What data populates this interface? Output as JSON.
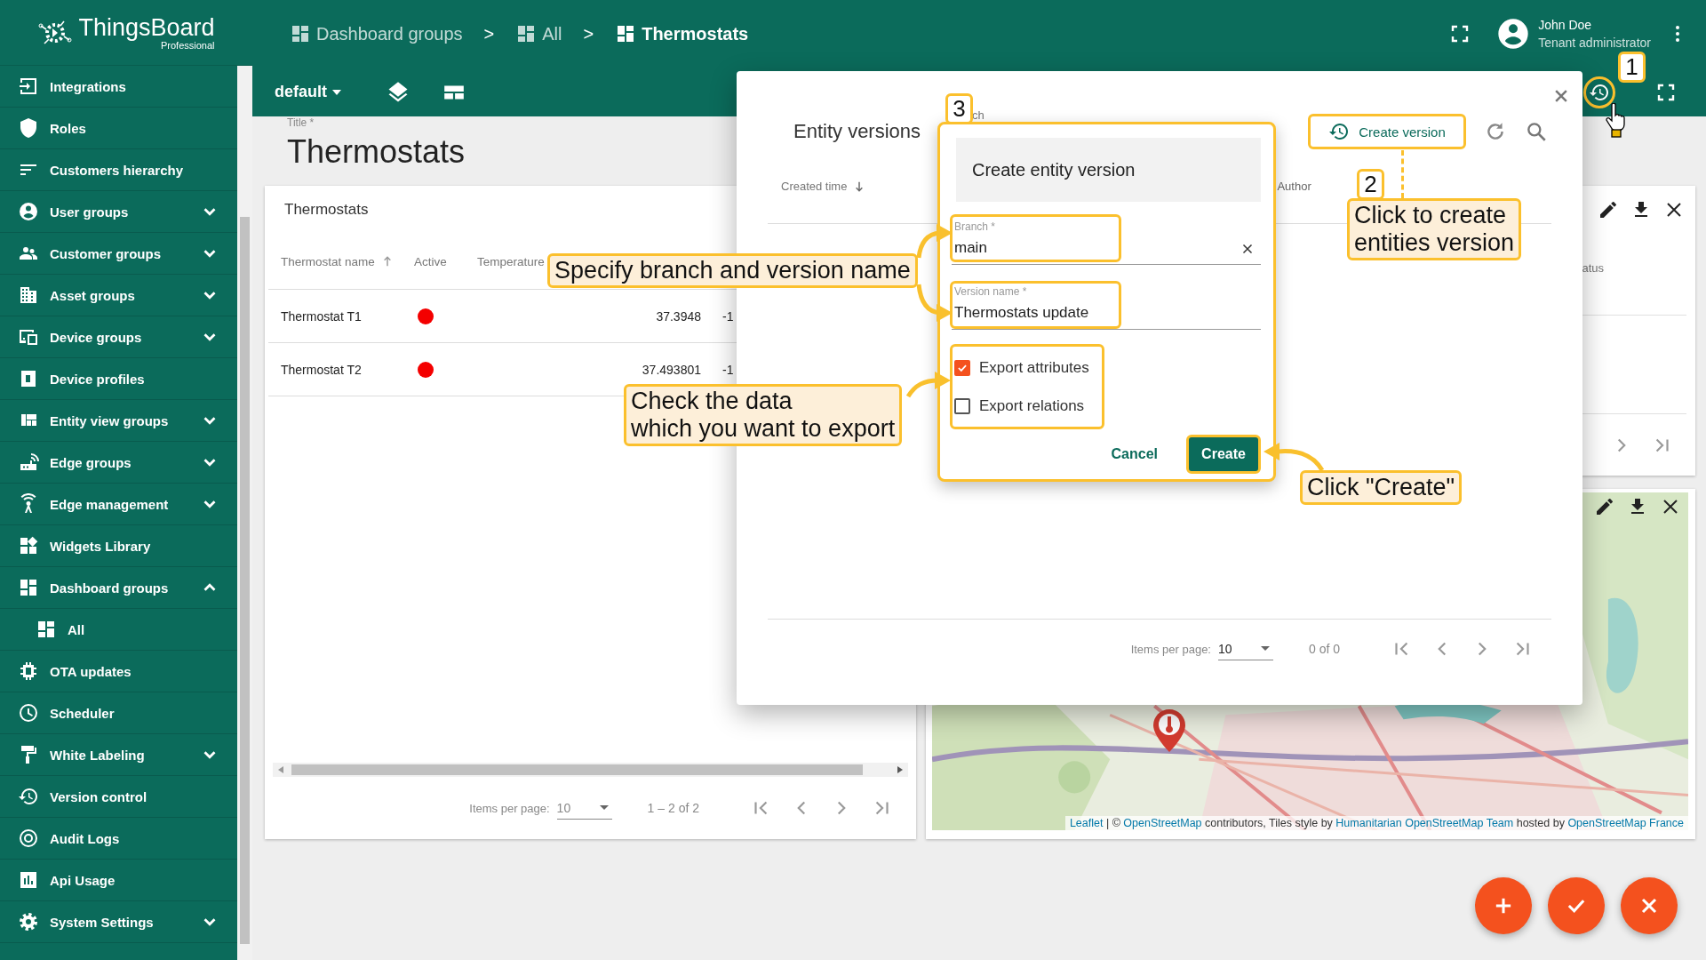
{
  "sidebar": {
    "logo": {
      "name": "ThingsBoard",
      "edition": "Professional"
    },
    "items": [
      {
        "label": "Integrations",
        "kind": "link"
      },
      {
        "label": "Roles",
        "kind": "link"
      },
      {
        "label": "Customers hierarchy",
        "kind": "link"
      },
      {
        "label": "User groups",
        "kind": "group",
        "expanded": false
      },
      {
        "label": "Customer groups",
        "kind": "group",
        "expanded": false
      },
      {
        "label": "Asset groups",
        "kind": "group",
        "expanded": false
      },
      {
        "label": "Device groups",
        "kind": "group",
        "expanded": false
      },
      {
        "label": "Device profiles",
        "kind": "link"
      },
      {
        "label": "Entity view groups",
        "kind": "group",
        "expanded": false
      },
      {
        "label": "Edge groups",
        "kind": "group",
        "expanded": false
      },
      {
        "label": "Edge management",
        "kind": "group",
        "expanded": false
      },
      {
        "label": "Widgets Library",
        "kind": "link"
      },
      {
        "label": "Dashboard groups",
        "kind": "group",
        "expanded": true,
        "children": [
          {
            "label": "All"
          }
        ]
      },
      {
        "label": "OTA updates",
        "kind": "link"
      },
      {
        "label": "Scheduler",
        "kind": "link"
      },
      {
        "label": "White Labeling",
        "kind": "group",
        "expanded": false
      },
      {
        "label": "Version control",
        "kind": "link"
      },
      {
        "label": "Audit Logs",
        "kind": "link"
      },
      {
        "label": "Api Usage",
        "kind": "link"
      },
      {
        "label": "System Settings",
        "kind": "group",
        "expanded": false
      }
    ]
  },
  "header": {
    "breadcrumbs": [
      {
        "label": "Dashboard groups",
        "selected": false
      },
      {
        "label": "All",
        "selected": false,
        "separator": ">"
      },
      {
        "label": "Thermostats",
        "selected": true,
        "separator": ">"
      }
    ],
    "user": {
      "name": "John Doe",
      "role": "Tenant administrator"
    }
  },
  "toolbar": {
    "state": "default"
  },
  "dashboard": {
    "title_label": "Title *",
    "title": "Thermostats"
  },
  "thermostats_widget": {
    "title": "Thermostats",
    "columns": [
      {
        "label": "Thermostat name",
        "sorted": true,
        "ascending": true
      },
      {
        "label": "Active",
        "sorted": false
      },
      {
        "label": "Temperature",
        "sorted": false
      }
    ],
    "rows": [
      {
        "name": "Thermostat T1",
        "color": "#f40000",
        "temperature": "37.3948",
        "column_4": "-1"
      },
      {
        "name": "Thermostat T2",
        "color": "#f40000",
        "temperature": "37.493801",
        "column_4": "-1"
      }
    ],
    "paginator": {
      "label": "Items per page:",
      "page_size": "10",
      "range": "1 – 2 of 2"
    }
  },
  "status_widget": {
    "column_header": "atus"
  },
  "map_widget": {
    "attribution": [
      {
        "text": "Leaflet",
        "kind": "link"
      },
      {
        "text": " | © ",
        "kind": "plain"
      },
      {
        "text": "OpenStreetMap",
        "kind": "link"
      },
      {
        "text": " contributors, Tiles style by ",
        "kind": "plain"
      },
      {
        "text": "Humanitarian OpenStreetMap Team",
        "kind": "link"
      },
      {
        "text": " hosted by ",
        "kind": "plain"
      },
      {
        "text": "OpenStreetMap France",
        "kind": "link"
      }
    ]
  },
  "versions_dialog": {
    "title": "Entity versions",
    "search_fragment": "ch",
    "create_button": "Create version",
    "columns": [
      {
        "label": "Created time",
        "sorted": true,
        "ascending": false
      },
      {
        "label": "Author",
        "sorted": false
      }
    ],
    "paginator": {
      "label": "Items per page:",
      "page_size": "10",
      "range": "0 of 0"
    }
  },
  "create_dialog": {
    "title": "Create entity version",
    "fields": [
      {
        "label": "Branch *",
        "value": "main",
        "clearable": true
      },
      {
        "label": "Version name *",
        "value": "Thermostats update",
        "clearable": false
      }
    ],
    "options": [
      {
        "label": "Export attributes",
        "checked": true
      },
      {
        "label": "Export relations",
        "checked": false
      }
    ],
    "buttons": [
      {
        "label": "Cancel",
        "kind": "text"
      },
      {
        "label": "Create",
        "kind": "primary"
      }
    ]
  },
  "annotations": {
    "badges": [
      "1",
      "2",
      "3"
    ],
    "callouts": [
      "Specify branch and version name",
      "Check the data\nwhich you want to export",
      "Click to create\nentities version",
      "Click \"Create\""
    ]
  }
}
